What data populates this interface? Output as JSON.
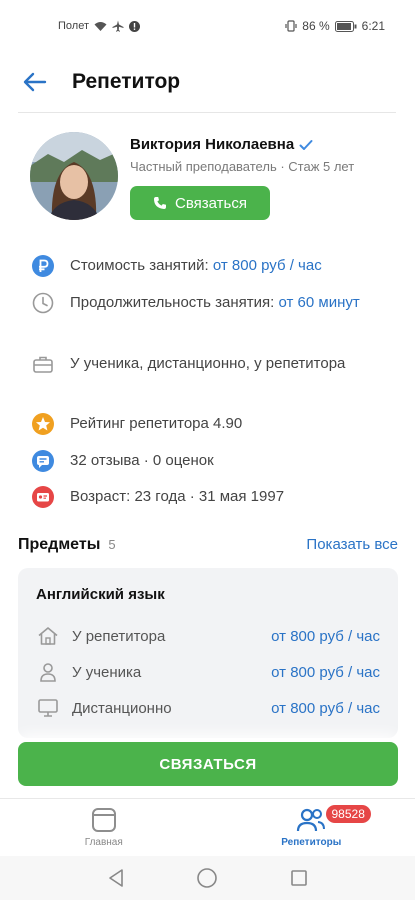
{
  "status_bar": {
    "airplane_label": "Полет",
    "battery": "86 %",
    "time": "6:21"
  },
  "header": {
    "title": "Репетитор"
  },
  "profile": {
    "name": "Виктория Николаевна",
    "subtitle": "Частный преподаватель · Стаж 5 лет",
    "contact_label": "Связаться"
  },
  "info": {
    "price_label": "Стоимость занятий: ",
    "price_value": "от 800 руб / час",
    "duration_label": "Продолжительность занятия: ",
    "duration_value": "от 60 минут",
    "location": "У ученика, дистанционно, у репетитора",
    "rating": "Рейтинг репетитора 4.90",
    "reviews": "32 отзыва · 0 оценок",
    "age": "Возраст: 23 года · 31 мая 1997"
  },
  "subjects": {
    "title": "Предметы",
    "count": "5",
    "show_all": "Показать все",
    "items": [
      {
        "name": "Английский язык",
        "prices": [
          {
            "icon": "house-icon",
            "label": "У репетитора",
            "value": "от 800 руб / час"
          },
          {
            "icon": "person-icon",
            "label": "У ученика",
            "value": "от 800 руб / час"
          },
          {
            "icon": "monitor-icon",
            "label": "Дистанционно",
            "value": "от 800 руб / час"
          }
        ]
      }
    ]
  },
  "contact_big_label": "СВЯЗАТЬСЯ",
  "bottom_nav": {
    "home_label": "Главная",
    "tutors_label": "Репетиторы",
    "badge": "98528"
  },
  "colors": {
    "accent": "#2a73c6",
    "green": "#4bb34b",
    "badge_red": "#e64646",
    "rating_star": "#f0a020",
    "reviews_blue": "#3f8ae0",
    "age_red": "#e64646"
  }
}
